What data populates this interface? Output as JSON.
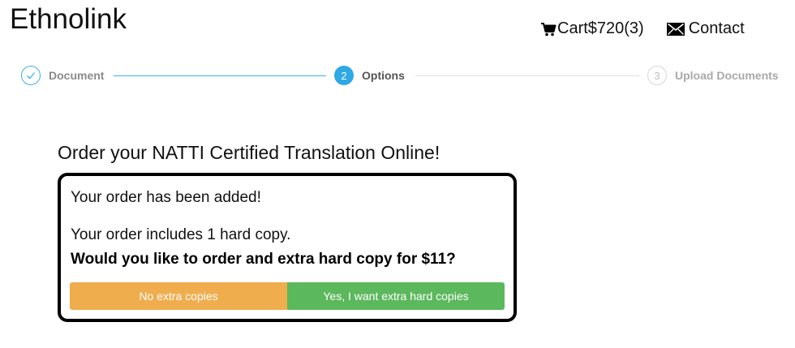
{
  "header": {
    "brand": "Ethnolink",
    "cart_label": "Cart$720(3)",
    "contact_label": "Contact",
    "icons": {
      "cart": "shopping-cart-icon",
      "contact": "envelope-icon"
    }
  },
  "stepper": {
    "steps": [
      {
        "number": "1",
        "label": "Document",
        "state": "completed"
      },
      {
        "number": "2",
        "label": "Options",
        "state": "active"
      },
      {
        "number": "3",
        "label": "Upload Documents",
        "state": "pending"
      }
    ]
  },
  "main": {
    "heading": "Order your NATTI Certified Translation Online!",
    "dialog": {
      "added_message": "Your order has been added!",
      "includes_message": "Your order includes 1 hard copy.",
      "question": "Would you like to order and extra hard copy for $11?",
      "no_button": "No extra copies",
      "yes_button": "Yes, I want extra hard copies"
    }
  },
  "colors": {
    "accent": "#2fa8e6",
    "no_button": "#f0ad4e",
    "yes_button": "#5cb85c"
  }
}
